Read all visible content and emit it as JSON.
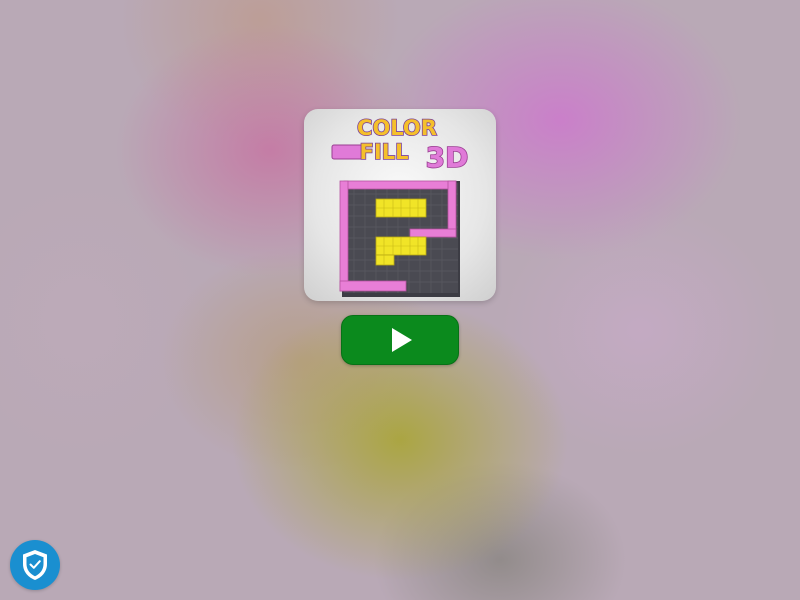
{
  "game": {
    "title_line1": "COLOR",
    "title_line2": "FILL",
    "title_suffix": "3D"
  },
  "play_button": {
    "icon": "play-icon"
  },
  "privacy_badge": {
    "icon": "shield-check-icon"
  },
  "colors": {
    "play_button": "#0b8a1d",
    "badge": "#1a8fd0",
    "title_yellow": "#f5c02b",
    "title_pink": "#e07ad8",
    "board_dark": "#4a4a52",
    "fill_pink": "#e87ed6",
    "fill_yellow": "#f1e427"
  }
}
